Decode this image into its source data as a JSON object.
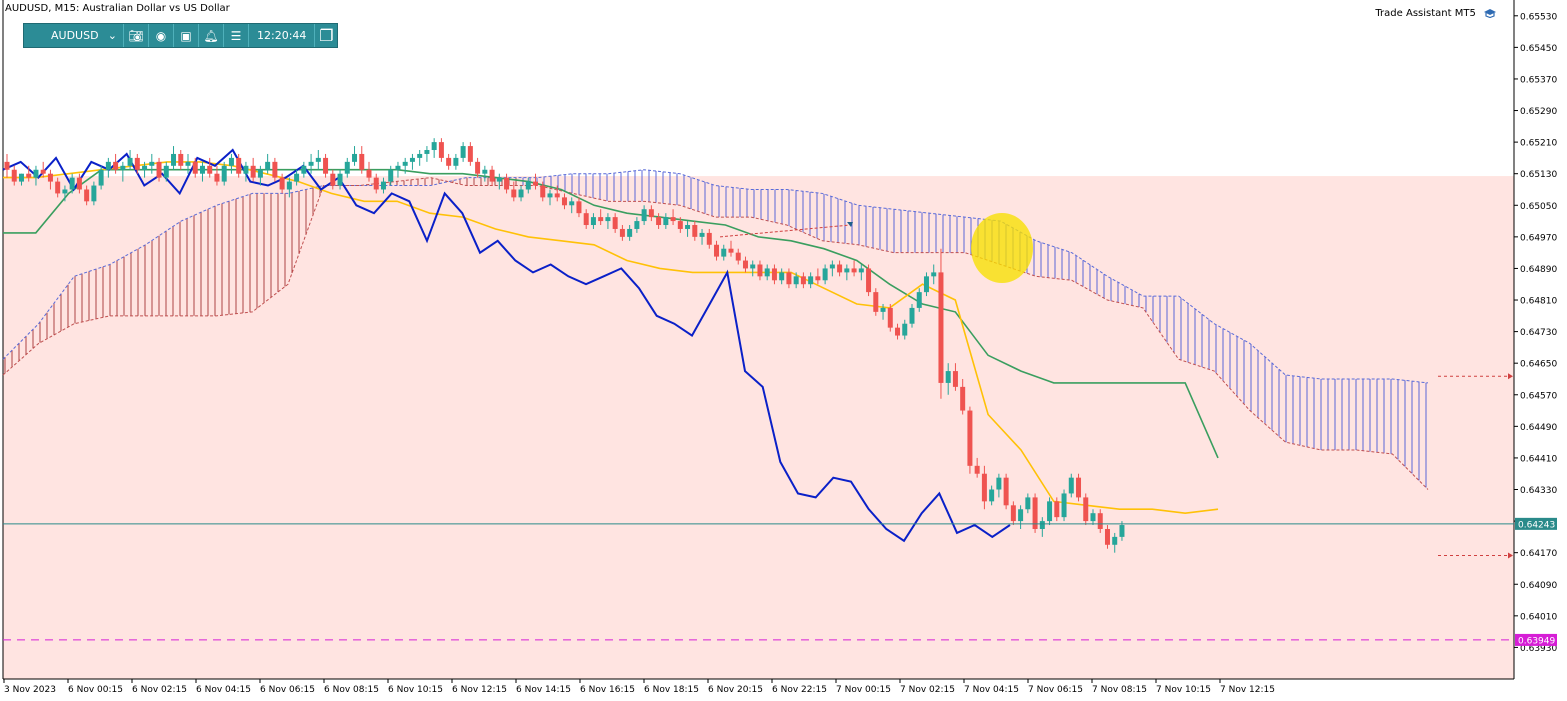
{
  "header": {
    "title": "AUDUSD, M15:  Australian Dollar vs US Dollar",
    "assistant": "Trade Assistant MT5"
  },
  "toolbar": {
    "symbol": "AUDUSD",
    "time": "12:20:44",
    "dropdown_icon": "chevron-down-icon",
    "buttons": [
      "camera-icon",
      "eye-icon",
      "calendar-icon",
      "alarm-bell-icon",
      "menu-icon",
      "window-icon"
    ]
  },
  "colors": {
    "bull": "#26a69a",
    "bear": "#ef5350",
    "cloud_bg": "#ffe4e1",
    "tenkan": "#ffc107",
    "kijun": "#3a9e5f",
    "chikou": "#0a20c8",
    "current_price": "#2a8a8a",
    "level_line": "#d61ed6"
  },
  "chart_data": {
    "type": "candlestick",
    "symbol": "AUDUSD",
    "timeframe": "M15",
    "ylim": [
      0.6385,
      0.6557
    ],
    "y_ticks": [
      "0.65530",
      "0.65450",
      "0.65370",
      "0.65290",
      "0.65210",
      "0.65130",
      "0.65050",
      "0.64970",
      "0.64890",
      "0.64810",
      "0.64730",
      "0.64650",
      "0.64570",
      "0.64490",
      "0.64410",
      "0.64330",
      "0.64250",
      "0.64170",
      "0.64090",
      "0.64010",
      "0.63930"
    ],
    "x_ticks": [
      "3 Nov 2023",
      "6 Nov 00:15",
      "6 Nov 02:15",
      "6 Nov 04:15",
      "6 Nov 06:15",
      "6 Nov 08:15",
      "6 Nov 10:15",
      "6 Nov 12:15",
      "6 Nov 14:15",
      "6 Nov 16:15",
      "6 Nov 18:15",
      "6 Nov 20:15",
      "6 Nov 22:15",
      "7 Nov 00:15",
      "7 Nov 02:15",
      "7 Nov 04:15",
      "7 Nov 06:15",
      "7 Nov 08:15",
      "7 Nov 10:15",
      "7 Nov 12:15"
    ],
    "candles": [
      [
        0.6516,
        0.6518,
        0.6512,
        0.6514
      ],
      [
        0.6514,
        0.6515,
        0.651,
        0.6511
      ],
      [
        0.6511,
        0.6513,
        0.651,
        0.6513
      ],
      [
        0.6513,
        0.6515,
        0.6511,
        0.6512
      ],
      [
        0.6512,
        0.6515,
        0.651,
        0.6514
      ],
      [
        0.6514,
        0.6516,
        0.6512,
        0.6513
      ],
      [
        0.6513,
        0.6514,
        0.6509,
        0.6511
      ],
      [
        0.6511,
        0.6512,
        0.6507,
        0.6508
      ],
      [
        0.6508,
        0.651,
        0.6506,
        0.6509
      ],
      [
        0.6509,
        0.6513,
        0.6508,
        0.6512
      ],
      [
        0.6512,
        0.6513,
        0.6508,
        0.6509
      ],
      [
        0.6509,
        0.651,
        0.6505,
        0.6506
      ],
      [
        0.6506,
        0.6511,
        0.6505,
        0.651
      ],
      [
        0.651,
        0.6515,
        0.6509,
        0.6514
      ],
      [
        0.6514,
        0.6517,
        0.6512,
        0.6516
      ],
      [
        0.6516,
        0.6518,
        0.6513,
        0.6514
      ],
      [
        0.6514,
        0.6516,
        0.6511,
        0.6515
      ],
      [
        0.6515,
        0.6519,
        0.6514,
        0.6517
      ],
      [
        0.6517,
        0.6518,
        0.6513,
        0.6514
      ],
      [
        0.6514,
        0.6516,
        0.6512,
        0.6515
      ],
      [
        0.6515,
        0.6518,
        0.6513,
        0.6516
      ],
      [
        0.6516,
        0.6517,
        0.6511,
        0.6512
      ],
      [
        0.6512,
        0.6516,
        0.6511,
        0.6515
      ],
      [
        0.6515,
        0.652,
        0.6514,
        0.6518
      ],
      [
        0.6518,
        0.6519,
        0.6514,
        0.6515
      ],
      [
        0.6515,
        0.6518,
        0.6513,
        0.6516
      ],
      [
        0.6516,
        0.6517,
        0.6512,
        0.6513
      ],
      [
        0.6513,
        0.6516,
        0.6511,
        0.6515
      ],
      [
        0.6515,
        0.6517,
        0.6512,
        0.6513
      ],
      [
        0.6513,
        0.6515,
        0.651,
        0.6511
      ],
      [
        0.6511,
        0.6516,
        0.651,
        0.6515
      ],
      [
        0.6515,
        0.6518,
        0.6513,
        0.6517
      ],
      [
        0.6517,
        0.6518,
        0.6512,
        0.6513
      ],
      [
        0.6513,
        0.6516,
        0.6511,
        0.6515
      ],
      [
        0.6515,
        0.6517,
        0.6511,
        0.6512
      ],
      [
        0.6512,
        0.6515,
        0.651,
        0.6514
      ],
      [
        0.6514,
        0.6518,
        0.6513,
        0.6516
      ],
      [
        0.6516,
        0.6517,
        0.6511,
        0.6512
      ],
      [
        0.6512,
        0.6513,
        0.6508,
        0.6509
      ],
      [
        0.6509,
        0.6512,
        0.6507,
        0.6511
      ],
      [
        0.6511,
        0.6514,
        0.651,
        0.6513
      ],
      [
        0.6513,
        0.6516,
        0.6512,
        0.6515
      ],
      [
        0.6515,
        0.6518,
        0.6513,
        0.6516
      ],
      [
        0.6516,
        0.6519,
        0.6514,
        0.6517
      ],
      [
        0.6517,
        0.6518,
        0.6512,
        0.6513
      ],
      [
        0.6513,
        0.6514,
        0.6509,
        0.651
      ],
      [
        0.651,
        0.6514,
        0.6509,
        0.6513
      ],
      [
        0.6513,
        0.6517,
        0.6512,
        0.6516
      ],
      [
        0.6516,
        0.652,
        0.6515,
        0.6518
      ],
      [
        0.6518,
        0.652,
        0.6513,
        0.6514
      ],
      [
        0.6514,
        0.6516,
        0.6511,
        0.6512
      ],
      [
        0.6512,
        0.6513,
        0.6508,
        0.6509
      ],
      [
        0.6509,
        0.6512,
        0.6508,
        0.6511
      ],
      [
        0.6511,
        0.6515,
        0.651,
        0.6514
      ],
      [
        0.6514,
        0.6516,
        0.6512,
        0.6515
      ],
      [
        0.6515,
        0.6517,
        0.6513,
        0.6516
      ],
      [
        0.6516,
        0.6518,
        0.6514,
        0.6517
      ],
      [
        0.6517,
        0.6519,
        0.6515,
        0.6518
      ],
      [
        0.6518,
        0.652,
        0.6516,
        0.6519
      ],
      [
        0.6519,
        0.6522,
        0.6517,
        0.6521
      ],
      [
        0.6521,
        0.6522,
        0.6516,
        0.6517
      ],
      [
        0.6517,
        0.6518,
        0.6514,
        0.6515
      ],
      [
        0.6515,
        0.6518,
        0.6514,
        0.6517
      ],
      [
        0.6517,
        0.6521,
        0.6516,
        0.652
      ],
      [
        0.652,
        0.6521,
        0.6515,
        0.6516
      ],
      [
        0.6516,
        0.6517,
        0.6512,
        0.6513
      ],
      [
        0.6513,
        0.6515,
        0.6511,
        0.6514
      ],
      [
        0.6514,
        0.6515,
        0.651,
        0.6511
      ],
      [
        0.6511,
        0.6513,
        0.6509,
        0.6512
      ],
      [
        0.6512,
        0.6513,
        0.6508,
        0.6509
      ],
      [
        0.6509,
        0.6511,
        0.6506,
        0.6507
      ],
      [
        0.6507,
        0.651,
        0.6506,
        0.6509
      ],
      [
        0.6509,
        0.6512,
        0.6508,
        0.6511
      ],
      [
        0.6511,
        0.6513,
        0.6509,
        0.651
      ],
      [
        0.651,
        0.6511,
        0.6506,
        0.6507
      ],
      [
        0.6507,
        0.6509,
        0.6505,
        0.6508
      ],
      [
        0.6508,
        0.651,
        0.6506,
        0.6507
      ],
      [
        0.6507,
        0.6508,
        0.6504,
        0.6505
      ],
      [
        0.6505,
        0.6507,
        0.6503,
        0.6506
      ],
      [
        0.6506,
        0.6507,
        0.6502,
        0.6503
      ],
      [
        0.6503,
        0.6504,
        0.6499,
        0.65
      ],
      [
        0.65,
        0.6503,
        0.6499,
        0.6502
      ],
      [
        0.6502,
        0.6504,
        0.65,
        0.6501
      ],
      [
        0.6501,
        0.6503,
        0.6499,
        0.6502
      ],
      [
        0.6502,
        0.6503,
        0.6498,
        0.6499
      ],
      [
        0.6499,
        0.65,
        0.6496,
        0.6497
      ],
      [
        0.6497,
        0.65,
        0.6496,
        0.6499
      ],
      [
        0.6499,
        0.6502,
        0.6498,
        0.6501
      ],
      [
        0.6501,
        0.6505,
        0.65,
        0.6504
      ],
      [
        0.6504,
        0.6505,
        0.6501,
        0.6502
      ],
      [
        0.6502,
        0.6503,
        0.6499,
        0.65
      ],
      [
        0.65,
        0.6503,
        0.6499,
        0.6502
      ],
      [
        0.6502,
        0.6504,
        0.65,
        0.6501
      ],
      [
        0.6501,
        0.6502,
        0.6498,
        0.6499
      ],
      [
        0.6499,
        0.6501,
        0.6497,
        0.65
      ],
      [
        0.65,
        0.6501,
        0.6496,
        0.6497
      ],
      [
        0.6497,
        0.6499,
        0.6495,
        0.6498
      ],
      [
        0.6498,
        0.6499,
        0.6494,
        0.6495
      ],
      [
        0.6495,
        0.6496,
        0.6491,
        0.6492
      ],
      [
        0.6492,
        0.6495,
        0.6491,
        0.6494
      ],
      [
        0.6494,
        0.6496,
        0.6492,
        0.6493
      ],
      [
        0.6493,
        0.6494,
        0.649,
        0.6491
      ],
      [
        0.6491,
        0.6492,
        0.6488,
        0.6489
      ],
      [
        0.6489,
        0.6491,
        0.6487,
        0.649
      ],
      [
        0.649,
        0.6491,
        0.6486,
        0.6487
      ],
      [
        0.6487,
        0.649,
        0.6486,
        0.6489
      ],
      [
        0.6489,
        0.649,
        0.6485,
        0.6486
      ],
      [
        0.6486,
        0.6489,
        0.6485,
        0.6488
      ],
      [
        0.6488,
        0.6489,
        0.6484,
        0.6485
      ],
      [
        0.6485,
        0.6488,
        0.6484,
        0.6487
      ],
      [
        0.6487,
        0.6488,
        0.6484,
        0.6485
      ],
      [
        0.6485,
        0.6488,
        0.6484,
        0.6487
      ],
      [
        0.6487,
        0.6489,
        0.6485,
        0.6486
      ],
      [
        0.6486,
        0.649,
        0.6485,
        0.6489
      ],
      [
        0.6489,
        0.6491,
        0.6487,
        0.649
      ],
      [
        0.649,
        0.6491,
        0.6487,
        0.6488
      ],
      [
        0.6488,
        0.649,
        0.6486,
        0.6489
      ],
      [
        0.6489,
        0.6491,
        0.6487,
        0.6488
      ],
      [
        0.6488,
        0.649,
        0.6486,
        0.6489
      ],
      [
        0.6489,
        0.649,
        0.6482,
        0.6483
      ],
      [
        0.6483,
        0.6484,
        0.6477,
        0.6478
      ],
      [
        0.6478,
        0.648,
        0.6476,
        0.6479
      ],
      [
        0.6479,
        0.648,
        0.6473,
        0.6474
      ],
      [
        0.6474,
        0.6475,
        0.6471,
        0.6472
      ],
      [
        0.6472,
        0.6476,
        0.6471,
        0.6475
      ],
      [
        0.6475,
        0.648,
        0.6474,
        0.6479
      ],
      [
        0.6479,
        0.6484,
        0.6478,
        0.6483
      ],
      [
        0.6483,
        0.6488,
        0.6482,
        0.6487
      ],
      [
        0.6487,
        0.649,
        0.6485,
        0.6488
      ],
      [
        0.6488,
        0.6494,
        0.6456,
        0.646
      ],
      [
        0.646,
        0.6465,
        0.6457,
        0.6463
      ],
      [
        0.6463,
        0.6465,
        0.6458,
        0.6459
      ],
      [
        0.6459,
        0.6461,
        0.6452,
        0.6453
      ],
      [
        0.6453,
        0.6454,
        0.6437,
        0.6439
      ],
      [
        0.6439,
        0.6441,
        0.6436,
        0.6437
      ],
      [
        0.6437,
        0.6439,
        0.6428,
        0.643
      ],
      [
        0.643,
        0.6434,
        0.6429,
        0.6433
      ],
      [
        0.6433,
        0.6437,
        0.6431,
        0.6436
      ],
      [
        0.6436,
        0.6437,
        0.6428,
        0.6429
      ],
      [
        0.6429,
        0.643,
        0.6424,
        0.6425
      ],
      [
        0.6425,
        0.6429,
        0.6423,
        0.6428
      ],
      [
        0.6428,
        0.6432,
        0.6427,
        0.6431
      ],
      [
        0.6431,
        0.6432,
        0.6422,
        0.6423
      ],
      [
        0.6423,
        0.6426,
        0.6421,
        0.6425
      ],
      [
        0.6425,
        0.6431,
        0.6424,
        0.643
      ],
      [
        0.643,
        0.6431,
        0.6425,
        0.6426
      ],
      [
        0.6426,
        0.6433,
        0.6425,
        0.6432
      ],
      [
        0.6432,
        0.6437,
        0.6431,
        0.6436
      ],
      [
        0.6436,
        0.6437,
        0.643,
        0.6431
      ],
      [
        0.6431,
        0.6432,
        0.6424,
        0.6425
      ],
      [
        0.6425,
        0.6428,
        0.6424,
        0.6427
      ],
      [
        0.6427,
        0.6428,
        0.6422,
        0.6423
      ],
      [
        0.6423,
        0.6424,
        0.6418,
        0.6419
      ],
      [
        0.6419,
        0.6422,
        0.6417,
        0.6421
      ],
      [
        0.6421,
        0.6425,
        0.642,
        0.6424
      ]
    ],
    "tenkan": [
      0.6512,
      0.6512,
      0.6513,
      0.6514,
      0.6515,
      0.6516,
      0.6516,
      0.6515,
      0.6513,
      0.6511,
      0.6508,
      0.6506,
      0.6506,
      0.6503,
      0.6502,
      0.6499,
      0.6497,
      0.6496,
      0.6495,
      0.6491,
      0.6489,
      0.6488,
      0.6488,
      0.6488,
      0.6488,
      0.6484,
      0.648,
      0.6479,
      0.6485,
      0.6481,
      0.6452,
      0.6443,
      0.643,
      0.6429,
      0.6428,
      0.6428,
      0.6427,
      0.6428
    ],
    "kijun": [
      0.6498,
      0.6498,
      0.6508,
      0.6514,
      0.6514,
      0.6514,
      0.6514,
      0.6514,
      0.6514,
      0.6514,
      0.6514,
      0.6514,
      0.6514,
      0.6513,
      0.6513,
      0.6512,
      0.6511,
      0.6509,
      0.6505,
      0.6503,
      0.6502,
      0.6501,
      0.65,
      0.6497,
      0.6496,
      0.6494,
      0.6491,
      0.6485,
      0.648,
      0.6478,
      0.6467,
      0.6463,
      0.646,
      0.646,
      0.646,
      0.646,
      0.646,
      0.6441
    ],
    "chikou": [
      0.6514,
      0.6516,
      0.6512,
      0.6517,
      0.6509,
      0.6516,
      0.6514,
      0.6518,
      0.651,
      0.6513,
      0.6508,
      0.6517,
      0.6515,
      0.6519,
      0.6511,
      0.651,
      0.6512,
      0.6515,
      0.6509,
      0.6512,
      0.6505,
      0.6503,
      0.6508,
      0.6506,
      0.6496,
      0.6508,
      0.6503,
      0.6493,
      0.6496,
      0.6491,
      0.6488,
      0.649,
      0.6487,
      0.6485,
      0.6487,
      0.6489,
      0.6484,
      0.6477,
      0.6475,
      0.6472,
      0.648,
      0.6488,
      0.6463,
      0.6459,
      0.644,
      0.6432,
      0.6431,
      0.6436,
      0.6435,
      0.6428,
      0.6423,
      0.642,
      0.6427,
      0.6432,
      0.6422,
      0.6424,
      0.6421,
      0.6424
    ],
    "cloud_top": [
      0.6466,
      0.6475,
      0.6487,
      0.649,
      0.6495,
      0.6501,
      0.6505,
      0.6508,
      0.6508,
      0.651,
      0.651,
      0.651,
      0.651,
      0.6512,
      0.6512,
      0.6512,
      0.6513,
      0.6513,
      0.6514,
      0.6513,
      0.651,
      0.6509,
      0.6509,
      0.6508,
      0.6505,
      0.6504,
      0.6503,
      0.6502,
      0.6501,
      0.6496,
      0.6493,
      0.6487,
      0.6482,
      0.6482,
      0.6475,
      0.647,
      0.6462,
      0.6461,
      0.6461,
      0.6461,
      0.646
    ],
    "cloud_bottom": [
      0.6462,
      0.647,
      0.6475,
      0.6477,
      0.6477,
      0.6477,
      0.6477,
      0.6478,
      0.6485,
      0.651,
      0.651,
      0.6511,
      0.6512,
      0.651,
      0.651,
      0.651,
      0.6508,
      0.6506,
      0.6506,
      0.6505,
      0.6502,
      0.6502,
      0.65,
      0.6496,
      0.6495,
      0.6493,
      0.6493,
      0.6493,
      0.649,
      0.6487,
      0.6486,
      0.6481,
      0.6479,
      0.6466,
      0.6463,
      0.6453,
      0.6445,
      0.6443,
      0.6443,
      0.6442,
      0.6433
    ],
    "current_price": "0.64243",
    "level_price": "0.63949",
    "current_price_value": 0.64243,
    "level_price_value": 0.63949,
    "cloud_bg_top": 0.65124
  }
}
